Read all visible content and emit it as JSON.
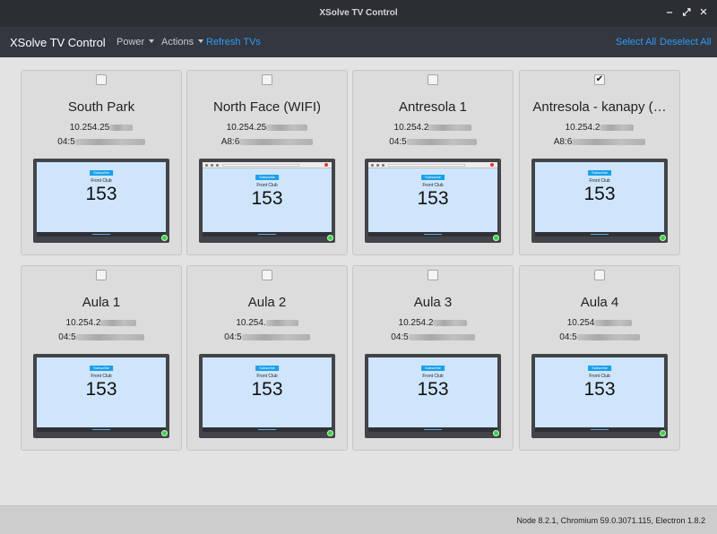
{
  "window": {
    "title": "XSolve TV Control",
    "buttons": [
      "‒",
      "⤢",
      "✕"
    ]
  },
  "navbar": {
    "brand": "XSolve TV Control",
    "power_label": "Power",
    "actions_label": "Actions",
    "refresh_label": "Refresh TVs",
    "select_all_label": "Select All",
    "deselect_all_label": "Deselect All"
  },
  "screen": {
    "subscribe_label": "Subscribe",
    "club_label": "Front Club",
    "count": "153"
  },
  "tvs": [
    {
      "name": "South Park",
      "ip_prefix": "10.254.25",
      "mac_prefix": "04:5",
      "checked": false,
      "variant": "plain"
    },
    {
      "name": "North Face (WIFI)",
      "ip_prefix": "10.254.25",
      "mac_prefix": "A8:6",
      "checked": false,
      "variant": "browser"
    },
    {
      "name": "Antresola 1",
      "ip_prefix": "10.254.2",
      "mac_prefix": "04:5",
      "checked": false,
      "variant": "browser"
    },
    {
      "name": "Antresola - kanapy (…",
      "ip_prefix": "10.254.2",
      "mac_prefix": "A8:6",
      "checked": true,
      "variant": "alt"
    },
    {
      "name": "Aula 1",
      "ip_prefix": "10.254.2",
      "mac_prefix": "04:5",
      "checked": false,
      "variant": "plain"
    },
    {
      "name": "Aula 2",
      "ip_prefix": "10.254.",
      "mac_prefix": "04:5",
      "checked": false,
      "variant": "plain"
    },
    {
      "name": "Aula 3",
      "ip_prefix": "10.254.2",
      "mac_prefix": "04:5",
      "checked": false,
      "variant": "plain"
    },
    {
      "name": "Aula 4",
      "ip_prefix": "10.254",
      "mac_prefix": "04:5",
      "checked": false,
      "variant": "alt"
    }
  ],
  "footer": {
    "versions": "Node 8.2.1, Chromium 59.0.3071.115, Electron 1.8.2"
  },
  "colors": {
    "titlebar": "#2b2e33",
    "navbar": "#333740",
    "link": "#2f9bf5",
    "status_online": "#39d24a",
    "screen_bg": "#cfe5fc"
  }
}
